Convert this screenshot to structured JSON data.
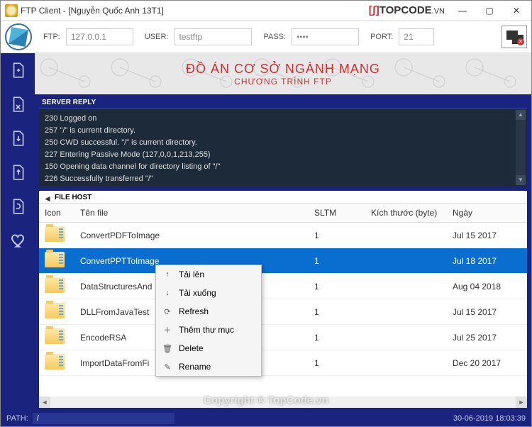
{
  "window": {
    "title": "FTP Client - [Nguyễn Quốc Anh 13T1]",
    "brand_prefix": "[ʃ]",
    "brand": "TOPCODE",
    "brand_suffix": ".VN"
  },
  "conn": {
    "ftp_label": "FTP:",
    "ftp_value": "127.0.0.1",
    "user_label": "USER:",
    "user_value": "testftp",
    "pass_label": "PASS:",
    "pass_value": "••••",
    "port_label": "PORT:",
    "port_value": "21"
  },
  "banner": {
    "title": "ĐỒ ÁN CƠ SỞ NGÀNH MẠNG",
    "subtitle": "CHƯƠNG TRÌNH  FTP"
  },
  "server_reply": {
    "label": "SERVER REPLY",
    "lines": "230 Logged on\n257 \"/\" is current directory.\n250 CWD successful. \"/\" is current directory.\n227 Entering Passive Mode (127,0,0,1,213,255)\n150 Opening data channel for directory listing of \"/\"\n226 Successfully transferred \"/\""
  },
  "file_host": {
    "label": "FILE HOST",
    "cols": {
      "icon": "Icon",
      "name": "Tên file",
      "sltm": "SLTM",
      "size": "Kích thước (byte)",
      "date": "Ngày"
    },
    "rows": [
      {
        "name": "ConvertPDFToImage",
        "sltm": "1",
        "size": "",
        "date": "Jul 15 2017"
      },
      {
        "name": "ConvertPPTToImage",
        "sltm": "1",
        "size": "",
        "date": "Jul 18 2017"
      },
      {
        "name": "DataStructuresAnd",
        "sltm": "1",
        "size": "",
        "date": "Aug 04 2018"
      },
      {
        "name": "DLLFromJavaTest",
        "sltm": "1",
        "size": "",
        "date": "Jul 15 2017"
      },
      {
        "name": "EncodeRSA",
        "sltm": "1",
        "size": "",
        "date": "Jul 25 2017"
      },
      {
        "name": "ImportDataFromFi",
        "sltm": "1",
        "size": "",
        "date": "Dec 20 2017"
      }
    ],
    "selected_index": 1
  },
  "context_menu": {
    "items": [
      {
        "icon": "↑",
        "label": "Tải lên"
      },
      {
        "icon": "↓",
        "label": "Tải xuống"
      },
      {
        "icon": "⟳",
        "label": "Refresh"
      },
      {
        "icon": "＋",
        "label": "Thêm thư mục"
      },
      {
        "icon": "🗑",
        "label": "Delete"
      },
      {
        "icon": "✎",
        "label": "Rename"
      }
    ]
  },
  "status": {
    "path_label": "PATH:",
    "path_value": "/",
    "datetime": "30-06-2019 18:03:39"
  },
  "watermark": "Copyright © TopCode.vn"
}
